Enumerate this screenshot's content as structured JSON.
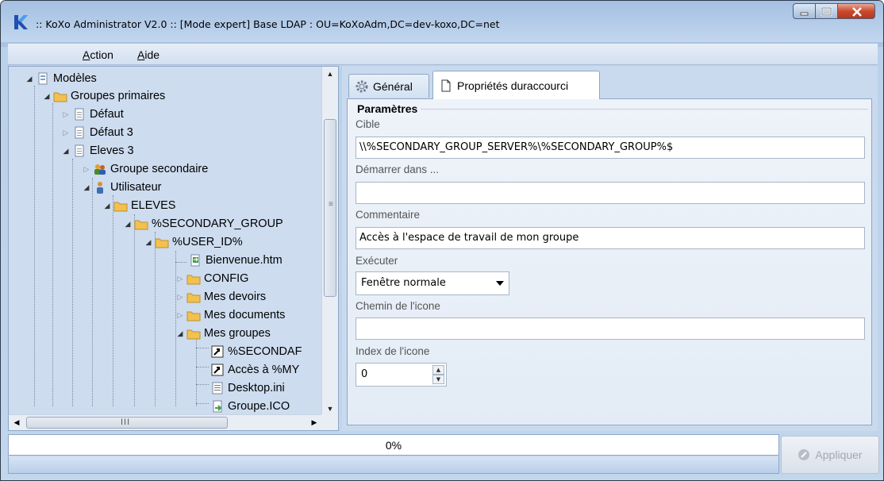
{
  "window": {
    "title": ":: KoXo Administrator V2.0 :: [Mode expert] Base LDAP : OU=KoXoAdm,DC=dev-koxo,DC=net"
  },
  "menu": {
    "items": [
      {
        "label_pre": "",
        "accel": "A",
        "label_post": "ction"
      },
      {
        "label_pre": "",
        "accel": "A",
        "label_post": "ide"
      }
    ]
  },
  "tree": {
    "items": [
      {
        "label": "Modèles",
        "icon": "template-icon",
        "expanded": true
      },
      {
        "label": "Groupes primaires",
        "icon": "folder-icon",
        "expanded": true
      },
      {
        "label": "Défaut",
        "icon": "file-icon",
        "expanded": false
      },
      {
        "label": "Défaut 3",
        "icon": "file-icon",
        "expanded": false
      },
      {
        "label": "Eleves 3",
        "icon": "file-icon",
        "expanded": true
      },
      {
        "label": "Groupe secondaire",
        "icon": "group-users-icon",
        "expanded": false
      },
      {
        "label": "Utilisateur",
        "icon": "user-icon",
        "expanded": true
      },
      {
        "label": "ELEVES",
        "icon": "folder-icon",
        "expanded": true
      },
      {
        "label": "%SECONDARY_GROUP",
        "icon": "folder-icon",
        "expanded": true
      },
      {
        "label": "%USER_ID%",
        "icon": "folder-icon",
        "expanded": true
      },
      {
        "label": "Bienvenue.htm",
        "icon": "html-file-icon",
        "expanded": null
      },
      {
        "label": "CONFIG",
        "icon": "folder-icon",
        "expanded": false
      },
      {
        "label": "Mes devoirs",
        "icon": "folder-icon",
        "expanded": false
      },
      {
        "label": "Mes documents",
        "icon": "folder-icon",
        "expanded": false
      },
      {
        "label": "Mes groupes",
        "icon": "folder-icon",
        "expanded": true
      },
      {
        "label": "%SECONDAF",
        "icon": "shortcut-icon",
        "expanded": null
      },
      {
        "label": "Accès à %MY",
        "icon": "shortcut-icon",
        "expanded": null
      },
      {
        "label": "Desktop.ini",
        "icon": "ini-file-icon",
        "expanded": null
      },
      {
        "label": "Groupe.ICO",
        "icon": "ico-file-icon",
        "expanded": null
      }
    ],
    "hscroll_grip": "III"
  },
  "tabs": [
    {
      "label": "Général",
      "icon": "gear-icon",
      "active": false
    },
    {
      "label": "Propriétés duraccourci",
      "icon": "page-icon",
      "active": true
    }
  ],
  "form": {
    "group_title": "Paramètres",
    "cible": {
      "label": "Cible",
      "value": "\\\\%SECONDARY_GROUP_SERVER%\\%SECONDARY_GROUP%$"
    },
    "demarrer": {
      "label": "Démarrer dans ...",
      "value": ""
    },
    "commentaire": {
      "label": "Commentaire",
      "value": "Accès à l'espace de travail de mon groupe"
    },
    "executer": {
      "label": "Exécuter",
      "value": "Fenêtre normale"
    },
    "chemin_icone": {
      "label": "Chemin de l'icone",
      "value": ""
    },
    "index_icone": {
      "label": "Index de l'icone",
      "value": "0"
    }
  },
  "status": {
    "progress_text": "0%",
    "progress_fraction": 0,
    "apply_label": "Appliquer"
  },
  "colors": {
    "accent": "#3ea14a",
    "folder": "#f2c14e"
  }
}
